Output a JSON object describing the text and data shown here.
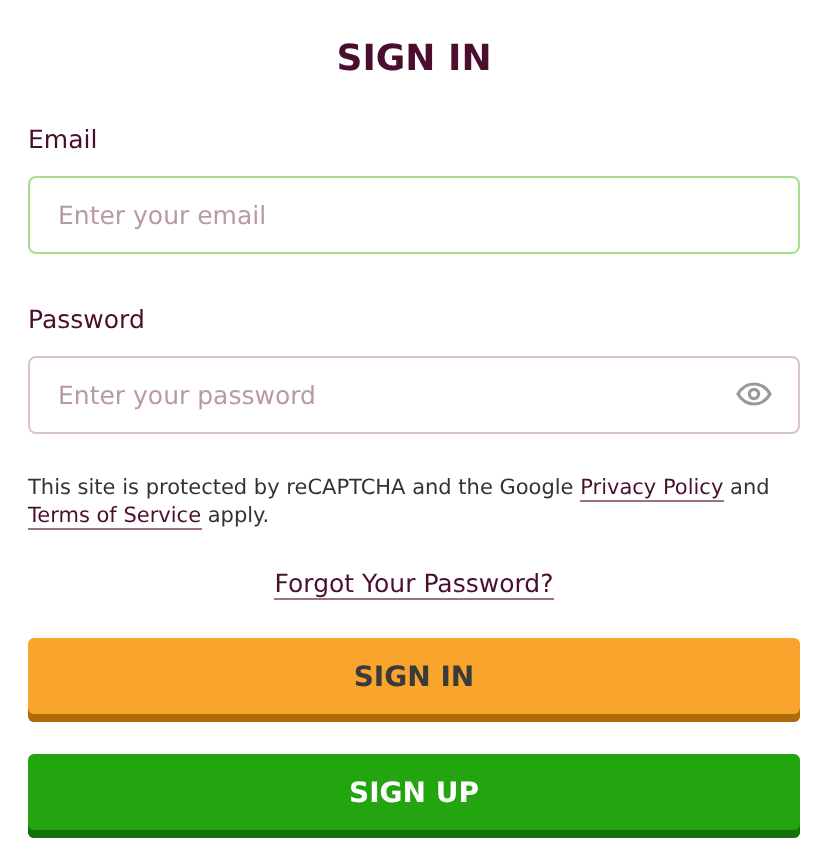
{
  "title": "SIGN IN",
  "fields": [
    {
      "label": "Email",
      "placeholder": "Enter your email",
      "focused": true,
      "reveal_toggle": false
    },
    {
      "label": "Password",
      "placeholder": "Enter your password",
      "focused": false,
      "reveal_toggle": true
    }
  ],
  "notice": [
    {
      "kind": "text",
      "text": "This site is protected by reCAPTCHA and the Google "
    },
    {
      "kind": "link",
      "text": "Privacy Policy"
    },
    {
      "kind": "text",
      "text": " and "
    },
    {
      "kind": "link",
      "text": "Terms of Service"
    },
    {
      "kind": "text",
      "text": " apply."
    }
  ],
  "forgot_link": "Forgot Your Password?",
  "buttons": [
    {
      "label": "SIGN IN",
      "kind": "primary"
    },
    {
      "label": "SIGN UP",
      "kind": "secondary"
    }
  ]
}
